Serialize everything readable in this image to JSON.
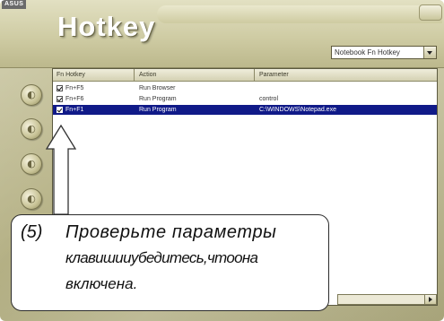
{
  "window": {
    "brand": "ASUS",
    "title": "Hotkey",
    "mode_select": "Notebook Fn Hotkey"
  },
  "table": {
    "headers": [
      "Fn Hotkey",
      "Action",
      "Parameter"
    ],
    "rows": [
      {
        "checked": true,
        "key": "Fn+F5",
        "action": "Run Browser",
        "param": "",
        "selected": false
      },
      {
        "checked": true,
        "key": "Fn+F6",
        "action": "Run Program",
        "param": "control",
        "selected": false
      },
      {
        "checked": true,
        "key": "Fn+F1",
        "action": "Run Program",
        "param": "C:\\WINDOWS\\Notepad.exe",
        "selected": true
      }
    ]
  },
  "side_buttons": [
    {
      "icon": "circle-button-1-icon"
    },
    {
      "icon": "circle-button-2-icon"
    },
    {
      "icon": "circle-button-3-icon"
    },
    {
      "icon": "circle-button-4-icon"
    }
  ],
  "callout": {
    "step": "(5)",
    "line1": "Проверьте параметры",
    "line2": "клавишииубедитесь,чтоона",
    "line3": "включена."
  },
  "colors": {
    "selection": "#101a88",
    "chrome": "#c8c59d"
  }
}
